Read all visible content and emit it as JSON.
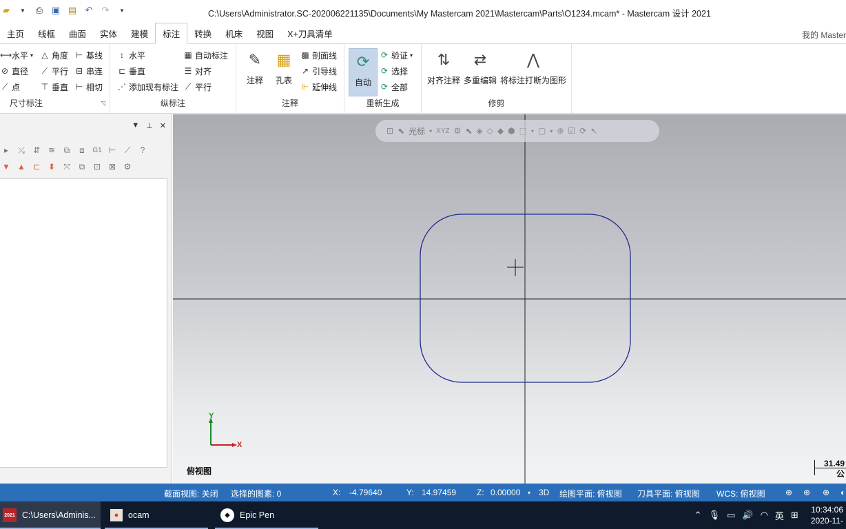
{
  "window": {
    "title": "C:\\Users\\Administrator.SC-202006221135\\Documents\\My Mastercam 2021\\Mastercam\\Parts\\O1234.mcam* - Mastercam 设计 2021"
  },
  "quick_access": [
    "folder-icon",
    "print-icon",
    "save-icon",
    "save-as-icon",
    "undo-icon",
    "redo-icon",
    "customize-icon"
  ],
  "tabs": [
    {
      "label": "主页"
    },
    {
      "label": "线框"
    },
    {
      "label": "曲面"
    },
    {
      "label": "实体"
    },
    {
      "label": "建模"
    },
    {
      "label": "标注",
      "active": true
    },
    {
      "label": "转换"
    },
    {
      "label": "机床"
    },
    {
      "label": "视图"
    },
    {
      "label": "X+刀具清单"
    }
  ],
  "tab_right": "我的 Master",
  "ribbon": {
    "dimension": {
      "label": "尺寸标注",
      "items": [
        "水平",
        "角度",
        "基线",
        "直径",
        "平行",
        "串连",
        "点",
        "垂直",
        "相切"
      ]
    },
    "ordinate": {
      "label": "纵标注",
      "items": [
        "水平",
        "自动标注",
        "垂直",
        "对齐",
        "添加现有标注",
        "平行"
      ]
    },
    "annotation": {
      "label": "注释",
      "big": [
        "注释",
        "孔表"
      ],
      "items": [
        "剖面线",
        "引导线",
        "延伸线"
      ]
    },
    "regenerate": {
      "label": "重新生成",
      "big": "自动",
      "items": [
        "验证",
        "选择",
        "全部"
      ]
    },
    "trim": {
      "label": "修剪",
      "big": [
        "对齐注释",
        "多重编辑",
        "将标注打断为图形"
      ]
    }
  },
  "viewport": {
    "toolbar_label": "光标",
    "toolbar_xyz": "XYZ",
    "view_name": "俯视图",
    "axis_x": "X",
    "axis_y": "Y",
    "scale_value": "31.49",
    "scale_unit": "公"
  },
  "status": {
    "section_view": "截面视图: 关闭",
    "selected": "选择的图素: 0",
    "x_label": "X:",
    "x_value": "-4.79640",
    "y_label": "Y:",
    "y_value": "14.97459",
    "z_label": "Z:",
    "z_value": "0.00000",
    "mode": "3D",
    "draw_plane": "绘图平面: 俯视图",
    "tool_plane": "刀具平面: 俯视图",
    "wcs": "WCS: 俯视图"
  },
  "taskbar": {
    "items": [
      {
        "label": "C:\\Users\\Adminis...",
        "icon_text": "2021"
      },
      {
        "label": "ocam"
      },
      {
        "label": "Epic Pen"
      }
    ],
    "ime": "英",
    "time": "10:34:06",
    "date": "2020-11-"
  },
  "colors": {
    "status_bar": "#2b6fba",
    "taskbar": "#0f1b2c",
    "geometry": "#1d2a8c",
    "axis_x": "#cc2222",
    "axis_y": "#1a8a2a"
  }
}
